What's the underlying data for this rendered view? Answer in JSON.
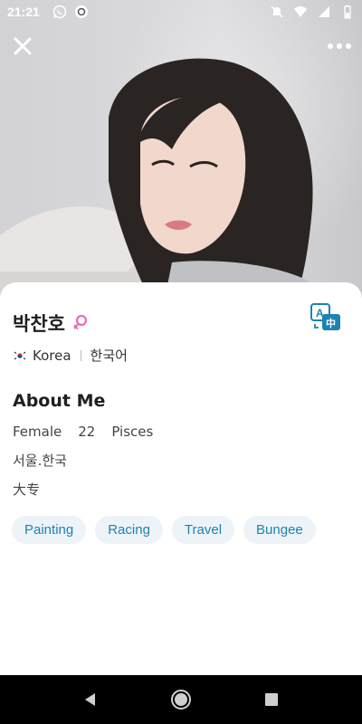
{
  "status_bar": {
    "time": "21:21",
    "left_icons": [
      "whatsapp-icon",
      "chat-bubble-icon"
    ],
    "right_icons": [
      "mute-icon",
      "wifi-icon",
      "signal-icon",
      "battery-icon"
    ]
  },
  "profile": {
    "name": "박찬호",
    "gender_symbol": "female",
    "country_flag": "korea-flag",
    "country": "Korea",
    "language": "한국어",
    "about_title": "About Me",
    "gender": "Female",
    "age": "22",
    "zodiac": "Pisces",
    "location": "서울.한국",
    "education": "大专",
    "tags": [
      "Painting",
      "Racing",
      "Travel",
      "Bungee"
    ]
  },
  "colors": {
    "accent": "#1c83b3",
    "tag_bg": "#eef3f7",
    "gender_icon": "#e56fb5"
  },
  "navigation": [
    "back-icon",
    "home-icon",
    "recents-icon"
  ]
}
